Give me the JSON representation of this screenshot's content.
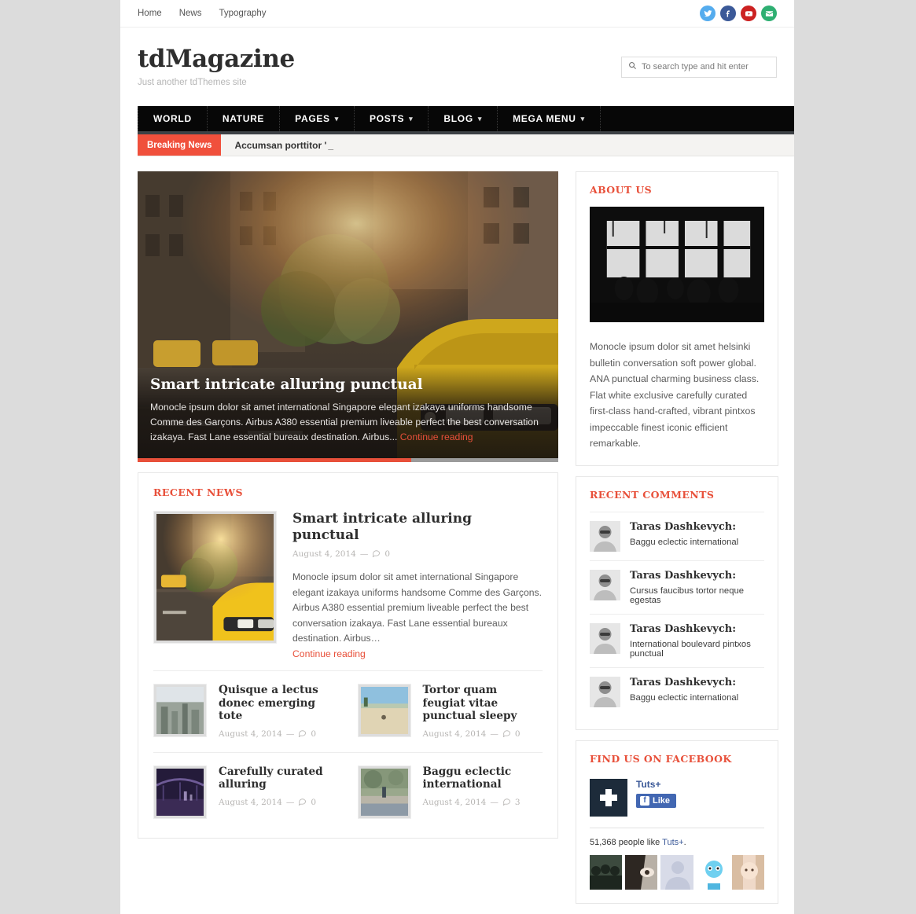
{
  "topbar": {
    "nav": [
      {
        "label": "Home"
      },
      {
        "label": "News"
      },
      {
        "label": "Typography"
      }
    ],
    "social": [
      {
        "name": "twitter",
        "color": "#55acee",
        "glyph": "t"
      },
      {
        "name": "facebook",
        "color": "#3b5998",
        "glyph": "f"
      },
      {
        "name": "youtube",
        "color": "#cc2222",
        "glyph": "y"
      },
      {
        "name": "email",
        "color": "#2eaf72",
        "glyph": "e"
      }
    ]
  },
  "masthead": {
    "title": "tdMagazine",
    "tagline": "Just another tdThemes site",
    "search_placeholder": "To search type and hit enter"
  },
  "mainnav": [
    {
      "label": "WORLD",
      "has_caret": false
    },
    {
      "label": "NATURE",
      "has_caret": false
    },
    {
      "label": "PAGES",
      "has_caret": true
    },
    {
      "label": "POSTS",
      "has_caret": true
    },
    {
      "label": "BLOG",
      "has_caret": true
    },
    {
      "label": "MEGA MENU",
      "has_caret": true
    }
  ],
  "breaking": {
    "badge": "Breaking News",
    "headline": "Accumsan porttitor '",
    "cursor": "_"
  },
  "hero": {
    "title": "Smart intricate alluring punctual",
    "excerpt": "Monocle ipsum dolor sit amet international Singapore elegant izakaya uniforms handsome Comme des Garçons. Airbus A380 essential premium liveable perfect the best conversation izakaya. Fast Lane essential bureaux destination. Airbus...",
    "readmore": "Continue reading",
    "progress_percent": 65,
    "progress_color": "#e8503a"
  },
  "recent_news": {
    "title": "RECENT NEWS",
    "featured": {
      "title": "Smart intricate alluring punctual",
      "date": "August 4, 2014",
      "separator": "—",
      "comments": "0",
      "excerpt": "Monocle ipsum dolor sit amet international Singapore elegant izakaya uniforms handsome Comme des Garçons. Airbus A380 essential premium liveable perfect the best conversation izakaya. Fast Lane essential bureaux destination. Airbus…",
      "readmore": "Continue reading"
    },
    "posts": [
      {
        "title": "Quisque a lectus donec emerging tote",
        "date": "August 4, 2014",
        "separator": "—",
        "comments": "0"
      },
      {
        "title": "Tortor quam feugiat vitae punctual sleepy",
        "date": "August 4, 2014",
        "separator": "—",
        "comments": "0"
      },
      {
        "title": "Carefully curated alluring",
        "date": "August 4, 2014",
        "separator": "—",
        "comments": "0"
      },
      {
        "title": "Baggu eclectic international",
        "date": "August 4, 2014",
        "separator": "—",
        "comments": "3"
      }
    ]
  },
  "sidebar": {
    "about": {
      "title": "ABOUT US",
      "text": "Monocle ipsum dolor sit amet helsinki bulletin conversation soft power global. ANA punctual charming business class. Flat white exclusive carefully curated first-class hand-crafted, vibrant pintxos impeccable finest iconic efficient remarkable."
    },
    "comments": {
      "title": "RECENT COMMENTS",
      "items": [
        {
          "author": "Taras Dashkevych:",
          "text": "Baggu eclectic international"
        },
        {
          "author": "Taras Dashkevych:",
          "text": "Cursus faucibus tortor neque egestas"
        },
        {
          "author": "Taras Dashkevych:",
          "text": "International boulevard pintxos punctual"
        },
        {
          "author": "Taras Dashkevych:",
          "text": "Baggu eclectic international"
        }
      ]
    },
    "facebook": {
      "title": "FIND US ON FACEBOOK",
      "page_name": "Tuts+",
      "like_label": "Like",
      "count_prefix": "51,368 people like ",
      "count_link": "Tuts+",
      "count_suffix": "."
    }
  },
  "colors": {
    "accent": "#e8503a",
    "nav_bg": "#070707",
    "body_bg": "#dcdcdc"
  }
}
